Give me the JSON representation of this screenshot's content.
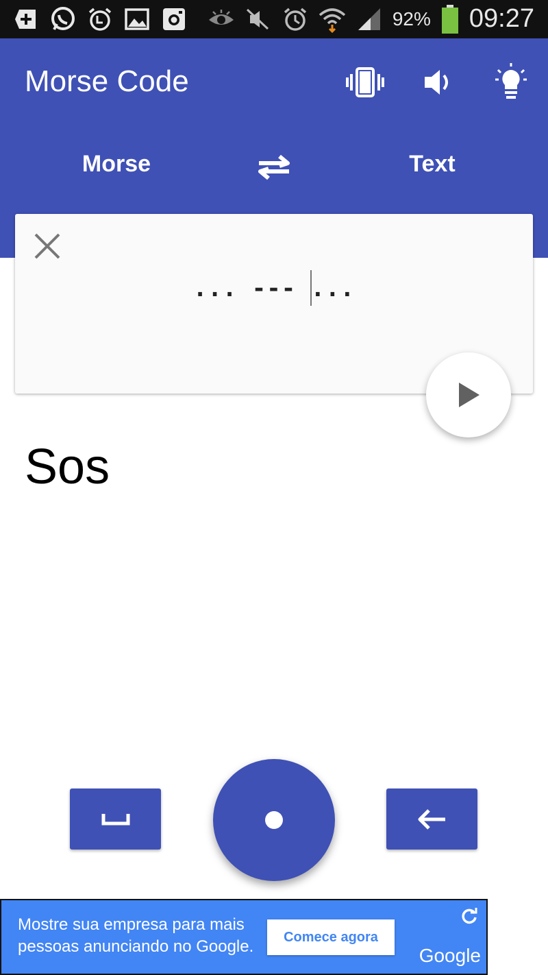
{
  "status_bar": {
    "battery": "92%",
    "time": "09:27",
    "left_icons": [
      "plus-app-icon",
      "whatsapp-icon",
      "alarm-clock-icon",
      "gallery-icon",
      "instagram-icon"
    ],
    "right_icons": [
      "eye-icon",
      "mute-icon",
      "alarm-icon",
      "wifi-icon",
      "signal-icon",
      "battery-icon"
    ]
  },
  "app_bar": {
    "title": "Morse Code",
    "actions": [
      "vibrate-icon",
      "volume-icon",
      "flashlight-icon"
    ],
    "source_lang": "Morse",
    "target_lang": "Text",
    "swap_icon": "swap-arrows-icon"
  },
  "input": {
    "before_caret": "... --- ",
    "after_caret": "...",
    "clear_icon": "close-icon",
    "play_icon": "play-icon"
  },
  "output": {
    "text": "Sos"
  },
  "keypad": {
    "space_icon": "space-bar-icon",
    "dot_icon": "dot-icon",
    "backspace_icon": "backspace-arrow-icon"
  },
  "ad": {
    "text": "Mostre sua empresa para mais pessoas anunciando no Google.",
    "button": "Comece agora",
    "logo": "Google",
    "refresh_icon": "refresh-icon"
  },
  "colors": {
    "primary": "#3f51b5",
    "status_bar": "#111111",
    "ad_blue": "#4285f4"
  }
}
